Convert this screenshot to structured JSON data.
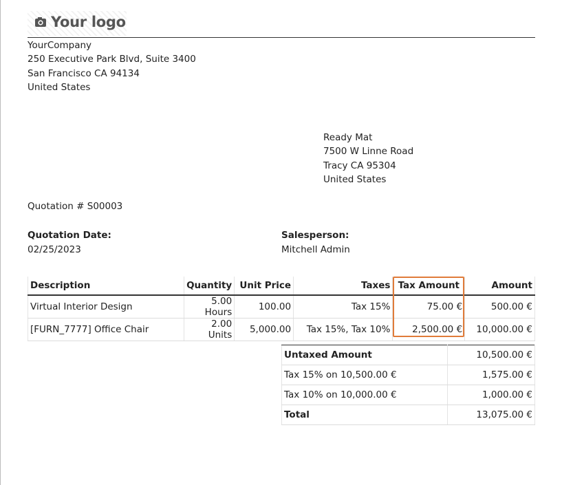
{
  "logo": {
    "text": "Your logo",
    "icon": "camera-icon"
  },
  "company": {
    "name": "YourCompany",
    "street": "250 Executive Park Blvd, Suite 3400",
    "city": "San Francisco CA 94134",
    "country": "United States"
  },
  "client": {
    "name": "Ready Mat",
    "street": "7500 W Linne Road",
    "city": "Tracy CA 95304",
    "country": "United States"
  },
  "quotation": {
    "number_label": "Quotation # S00003",
    "date_label": "Quotation Date:",
    "date_value": "02/25/2023",
    "salesperson_label": "Salesperson:",
    "salesperson_value": "Mitchell Admin"
  },
  "lines_table": {
    "headers": [
      "Description",
      "Quantity",
      "Unit Price",
      "Taxes",
      "Tax Amount",
      "Amount"
    ],
    "rows": [
      [
        "Virtual Interior Design",
        "5.00 Hours",
        "100.00",
        "Tax 15%",
        "75.00 €",
        "500.00 €"
      ],
      [
        "[FURN_7777] Office Chair",
        "2.00 Units",
        "5,000.00",
        "Tax 15%, Tax 10%",
        "2,500.00 €",
        "10,000.00 €"
      ]
    ]
  },
  "totals": [
    {
      "label": "Untaxed Amount",
      "value": "10,500.00 €",
      "bold": true
    },
    {
      "label": "Tax 15% on 10,500.00 €",
      "value": "1,575.00 €",
      "bold": false
    },
    {
      "label": "Tax 10% on 10,000.00 €",
      "value": "1,000.00 €",
      "bold": false
    },
    {
      "label": "Total",
      "value": "13,075.00 €",
      "bold": true
    }
  ],
  "colors": {
    "highlight": "#e07b39",
    "text": "#222222"
  }
}
